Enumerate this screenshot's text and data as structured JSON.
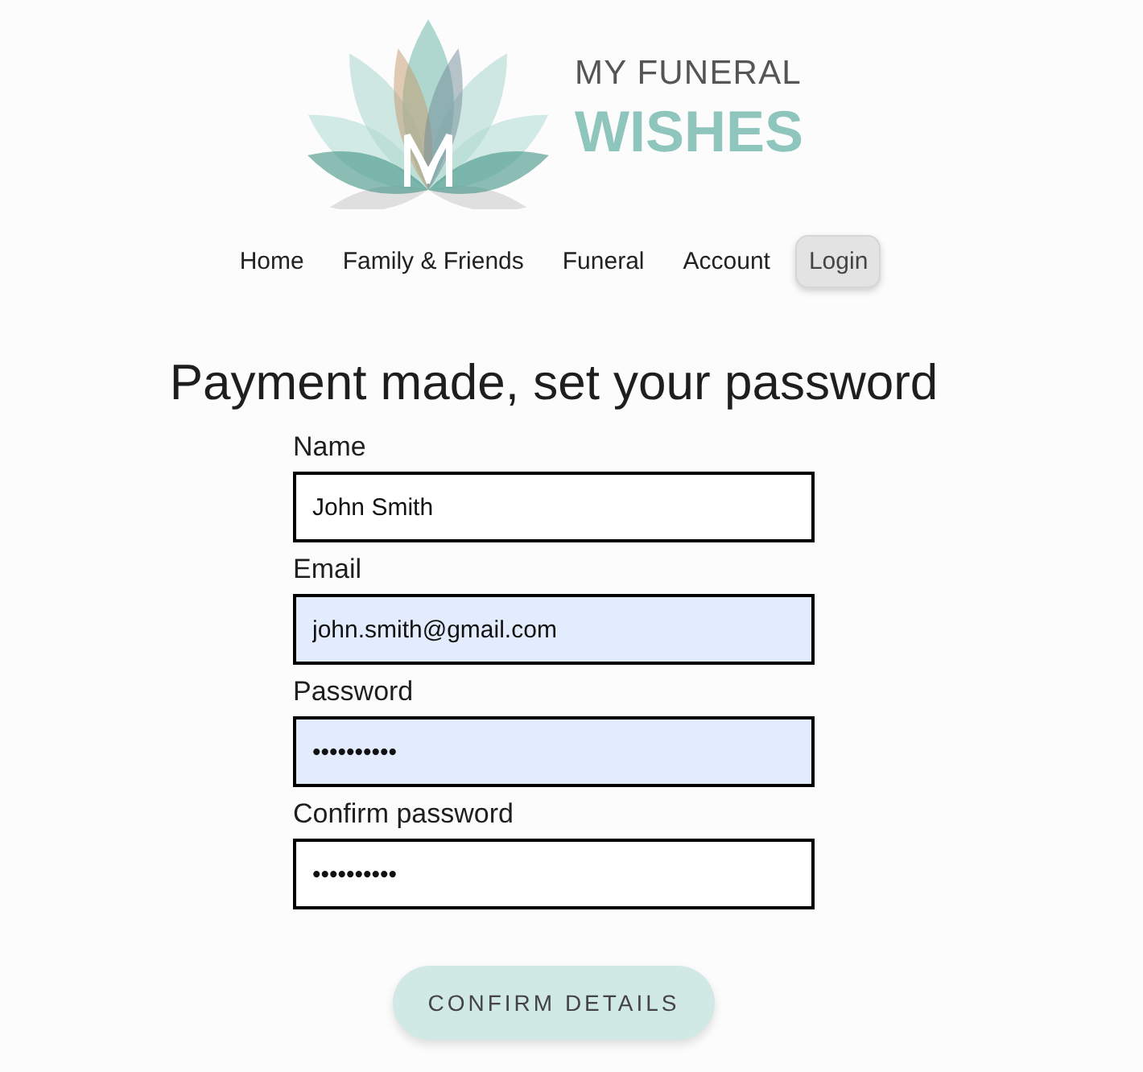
{
  "logo": {
    "line_1": "MY FUNERAL",
    "line_2": "WISHES"
  },
  "nav": [
    {
      "label": "Home",
      "kind": "link"
    },
    {
      "label": "Family & Friends",
      "kind": "link"
    },
    {
      "label": "Funeral",
      "kind": "link"
    },
    {
      "label": "Account",
      "kind": "link"
    },
    {
      "label": "Login",
      "kind": "button"
    }
  ],
  "heading": "Payment made, set your password",
  "fields": [
    {
      "label": "Name",
      "value": "John Smith",
      "autofilled": false
    },
    {
      "label": "Email",
      "value": "john.smith@gmail.com",
      "autofilled": true
    },
    {
      "label": "Password",
      "value": "••••••••••",
      "autofilled": true
    },
    {
      "label": "Confirm password",
      "value": "••••••••••",
      "autofilled": false
    }
  ],
  "submit": {
    "label": "CONFIRM DETAILS"
  }
}
